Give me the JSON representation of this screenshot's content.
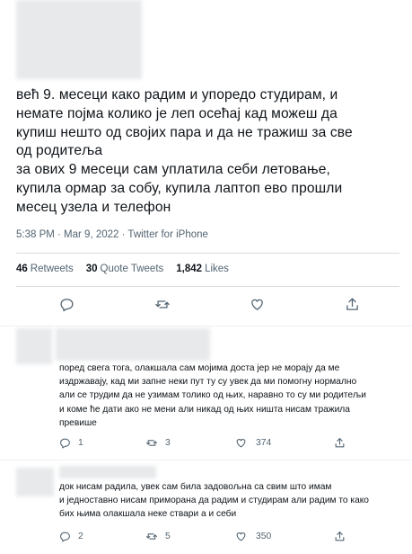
{
  "main_tweet": {
    "text_lines": [
      "већ 9. месеци како радим и упоредо студирам, и",
      "немате појма колико је леп осећај кад можеш да",
      "купиш нешто од својих пара и да не тражиш за све",
      "од родитеља",
      "за ових 9 месеци сам уплатила себи летовање,",
      "купила ормар за собу, купила лаптоп ево прошли",
      "месец узела и телефон"
    ],
    "timestamp": "5:38 PM · Mar 9, 2022 · Twitter for iPhone",
    "retweets_count": "46",
    "retweets_label": "Retweets",
    "quote_count": "30",
    "quote_label": "Quote Tweets",
    "likes_count": "1,842",
    "likes_label": "Likes"
  },
  "replies": [
    {
      "text_lines": [
        "поред свега тога, олакшала сам мојима доста јер не морају да ме",
        "издржавају, кад ми запне неки пут ту су увек да ми помогну нормално",
        "али се трудим да не узимам толико од њих, наравно то су ми родитељи",
        "и коме ће дати ако не мени али никад од њих ништа нисам тражила",
        "превише"
      ],
      "reply_count": "1",
      "retweet_count": "3",
      "like_count": "374"
    },
    {
      "text_lines": [
        "док нисам радила, увек сам била задовољна са свим што имам",
        "и једноставно нисам приморана да радим и студирам али радим то како",
        "бих њима олакшала неке ствари а и себи"
      ],
      "reply_count": "2",
      "retweet_count": "5",
      "like_count": "350"
    }
  ],
  "colors": {
    "text": "#0f1419",
    "secondary": "#536471",
    "divider": "#d7dbdf",
    "redaction": "#e7e9eb"
  },
  "icons": [
    "reply-icon",
    "retweet-icon",
    "like-icon",
    "share-icon"
  ]
}
